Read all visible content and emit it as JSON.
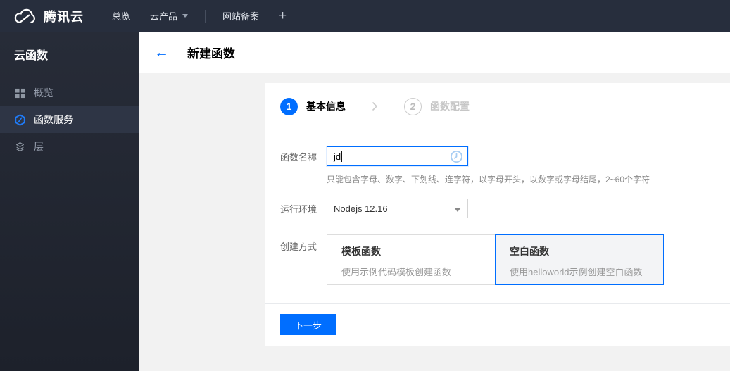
{
  "topbar": {
    "brand": "腾讯云",
    "nav": [
      {
        "label": "总览"
      },
      {
        "label": "云产品"
      },
      {
        "label": "网站备案"
      }
    ],
    "plus": "+"
  },
  "sidebar": {
    "title": "云函数",
    "items": [
      {
        "label": "概览",
        "icon": "grid-icon",
        "selected": false
      },
      {
        "label": "函数服务",
        "icon": "scf-hexagon-icon",
        "selected": true
      },
      {
        "label": "层",
        "icon": "layers-icon",
        "selected": false
      }
    ]
  },
  "header": {
    "back_icon": "←",
    "title": "新建函数"
  },
  "wizard": {
    "steps": [
      {
        "num": "1",
        "label": "基本信息",
        "active": true
      },
      {
        "num": "2",
        "label": "函数配置",
        "active": false
      }
    ]
  },
  "form": {
    "name": {
      "label": "函数名称",
      "value": "jd",
      "hint": "只能包含字母、数字、下划线、连字符，以字母开头，以数字或字母结尾，2~60个字符"
    },
    "runtime": {
      "label": "运行环境",
      "value": "Nodejs 12.16"
    },
    "method": {
      "label": "创建方式",
      "options": [
        {
          "title": "模板函数",
          "desc": "使用示例代码模板创建函数",
          "selected": false
        },
        {
          "title": "空白函数",
          "desc": "使用helloworld示例创建空白函数",
          "selected": true
        }
      ]
    }
  },
  "actions": {
    "next": "下一步"
  },
  "icons": [
    "tencent-cloud-logo",
    "caret-down",
    "plus",
    "grid",
    "scf-hexagon",
    "layers",
    "back-arrow",
    "chevron-right",
    "clock",
    "select-caret"
  ],
  "colors": {
    "accent": "#006eff",
    "topbar_bg": "#272e3d",
    "sidebar_bg": "#20252f",
    "sidebar_selected_bg": "#2e3545",
    "page_bg": "#f2f2f2"
  }
}
